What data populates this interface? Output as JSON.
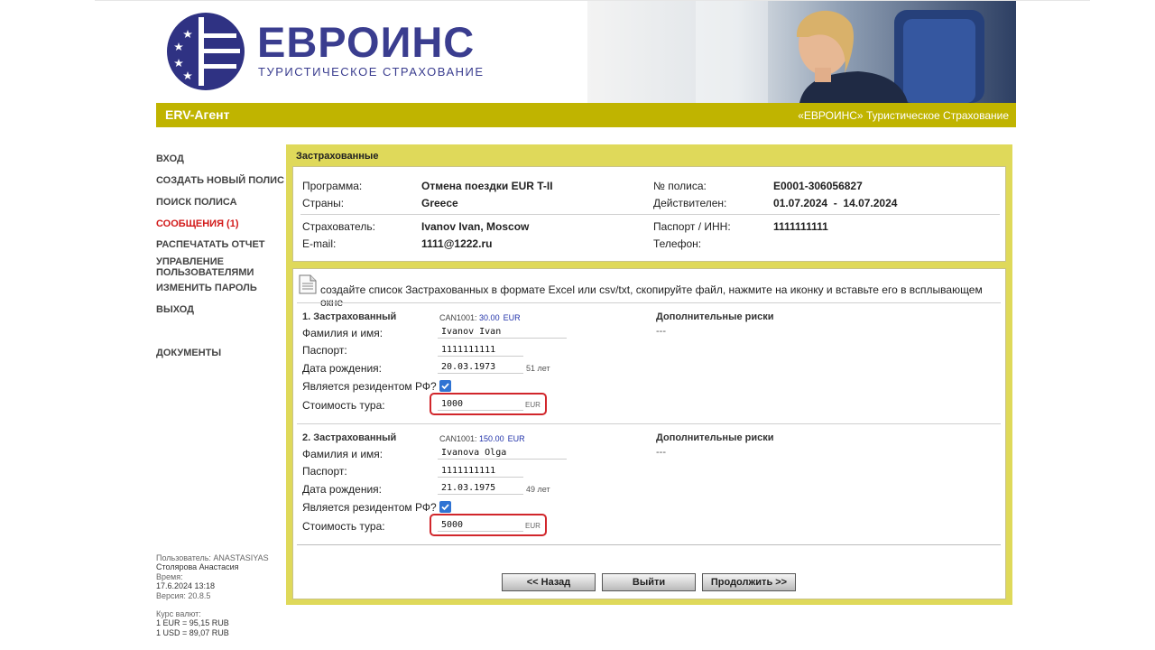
{
  "header": {
    "brand": "ЕВРОИНС",
    "brand_sub": "ТУРИСТИЧЕСКОЕ СТРАХОВАНИЕ",
    "bar_left": "ERV-Агент",
    "bar_right": "«ЕВРОИНС» Туристическое Страхование",
    "accent_color": "#c0b400"
  },
  "nav": {
    "items": [
      {
        "label": "ВХОД"
      },
      {
        "label": "СОЗДАТЬ НОВЫЙ ПОЛИС"
      },
      {
        "label": "ПОИСК ПОЛИСА"
      },
      {
        "label": "СООБЩЕНИЯ (1)"
      },
      {
        "label": "РАСПЕЧАТАТЬ ОТЧЕТ"
      },
      {
        "label": "УПРАВЛЕНИЕ ПОЛЬЗОВАТЕЛЯМИ"
      },
      {
        "label": "ИЗМЕНИТЬ ПАРОЛЬ"
      },
      {
        "label": "ВЫХОД"
      },
      {
        "label": "ДОКУМЕНТЫ"
      }
    ]
  },
  "user_info": {
    "user_label": "Пользователь: ANASTASIYAS",
    "user_name": "Столярова Анастасия",
    "time_label": "Время:",
    "time": "17.6.2024 13:18",
    "version": "Версия: 20.8.5",
    "rates_label": "Курс валют:",
    "rate_eur": "1 EUR = 95,15 RUB",
    "rate_usd": "1 USD = 89,07 RUB"
  },
  "panel": {
    "title": "Застрахованные",
    "policy": {
      "program_label": "Программа:",
      "program": "Отмена поездки EUR T-II",
      "countries_label": "Страны:",
      "countries": "Greece",
      "policy_no_label": "№ полиса:",
      "policy_no": "E0001-306056827",
      "valid_label": "Действителен:",
      "valid": "01.07.2024  -  14.07.2024",
      "holder_label": "Страхователь:",
      "holder": "Ivanov Ivan, Moscow",
      "email_label": "E-mail:",
      "email": "1111@1222.ru",
      "passport_label": "Паспорт / ИНН:",
      "passport": "1111111111",
      "phone_label": "Телефон:"
    },
    "hint": "создайте список Застрахованных в формате Excel или csv/txt, скопируйте файл, нажмите на иконку и вставьте его в всплывающем окне",
    "labels": {
      "name": "Фамилия и имя:",
      "passport": "Паспорт:",
      "birth": "Дата рождения:",
      "resident": "Является резидентом РФ?",
      "cost": "Стоимость тура:",
      "risks": "Дополнительные риски",
      "currency": "EUR"
    },
    "insured": [
      {
        "title": "1. Застрахованный",
        "code": "CAN1001:",
        "amount": "30.00",
        "amount_cur": "EUR",
        "name": "Ivanov Ivan",
        "passport": "1111111111",
        "birth": "20.03.1973",
        "age": "51 лет",
        "resident": true,
        "cost": "1000",
        "risks": "---"
      },
      {
        "title": "2. Застрахованный",
        "code": "CAN1001:",
        "amount": "150.00",
        "amount_cur": "EUR",
        "name": "Ivanova Olga",
        "passport": "1111111111",
        "birth": "21.03.1975",
        "age": "49 лет",
        "resident": true,
        "cost": "5000",
        "risks": "---"
      }
    ],
    "buttons": {
      "back": "<< Назад",
      "exit": "Выйти",
      "next": "Продолжить >>"
    }
  }
}
